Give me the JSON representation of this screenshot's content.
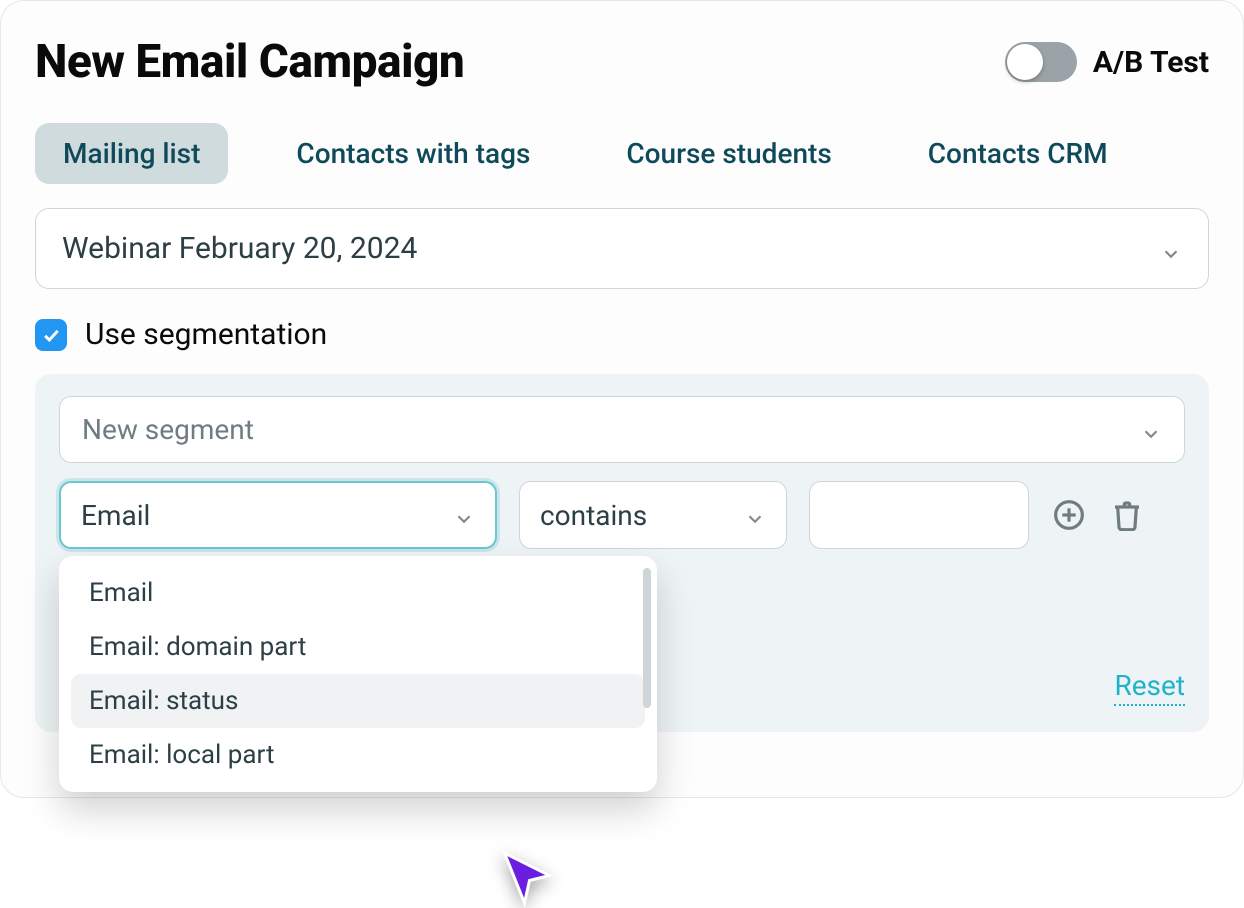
{
  "header": {
    "title": "New Email Campaign",
    "ab_test_label": "A/B Test",
    "ab_test_on": false
  },
  "tabs": [
    {
      "label": "Mailing list",
      "active": true
    },
    {
      "label": "Contacts with tags",
      "active": false
    },
    {
      "label": "Course students",
      "active": false
    },
    {
      "label": "Contacts CRM",
      "active": false
    }
  ],
  "mailing_list_select": {
    "value": "Webinar February 20, 2024"
  },
  "segmentation": {
    "checkbox_label": "Use segmentation",
    "checked": true,
    "segment_select": {
      "placeholder": "New segment"
    },
    "rule": {
      "field": "Email",
      "operator": "contains",
      "value": ""
    },
    "field_dropdown_open": true,
    "field_options": [
      {
        "label": "Email",
        "hover": false
      },
      {
        "label": "Email: domain part",
        "hover": false
      },
      {
        "label": "Email: status",
        "hover": true
      },
      {
        "label": "Email: local part",
        "hover": false
      }
    ],
    "reset_label": "Reset"
  },
  "icons": {
    "chevron_down": "chevron-down-icon",
    "check": "check-icon",
    "plus_circle": "plus-circle-icon",
    "trash": "trash-icon",
    "cursor": "cursor-icon"
  }
}
